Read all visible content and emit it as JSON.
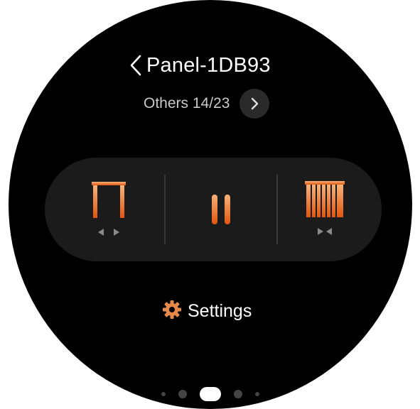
{
  "header": {
    "title": "Panel-1DB93"
  },
  "category": {
    "label": "Others 14/23"
  },
  "controls": {
    "items": [
      {
        "name": "open-curtain",
        "icon": "curtain-open-icon"
      },
      {
        "name": "pause",
        "icon": "pause-icon"
      },
      {
        "name": "close-curtain",
        "icon": "curtain-close-icon"
      }
    ],
    "accent_light": "#f7b27a",
    "accent_dark": "#e0560e"
  },
  "settings": {
    "label": "Settings",
    "icon": "gear-icon",
    "icon_color": "#e58a4a"
  },
  "pagination": {
    "total": 5,
    "active_index": 2
  }
}
